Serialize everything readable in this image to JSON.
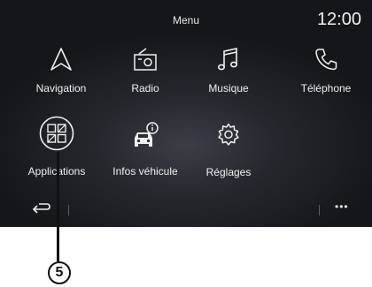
{
  "header": {
    "title": "Menu",
    "clock": "12:00"
  },
  "apps": [
    {
      "label": "Navigation",
      "icon": "navigation-icon"
    },
    {
      "label": "Radio",
      "icon": "radio-icon"
    },
    {
      "label": "Musique",
      "icon": "music-note-icon"
    },
    {
      "label": "Téléphone",
      "icon": "phone-icon"
    },
    {
      "label": "Applications",
      "icon": "applications-grid-icon"
    },
    {
      "label": "Infos véhicule",
      "icon": "vehicle-info-icon"
    },
    {
      "label": "Réglages",
      "icon": "gear-icon"
    }
  ],
  "bottom_bar": {
    "back_icon": "back-arrow-icon",
    "more_label": "•••"
  },
  "callout": {
    "number": "5"
  }
}
